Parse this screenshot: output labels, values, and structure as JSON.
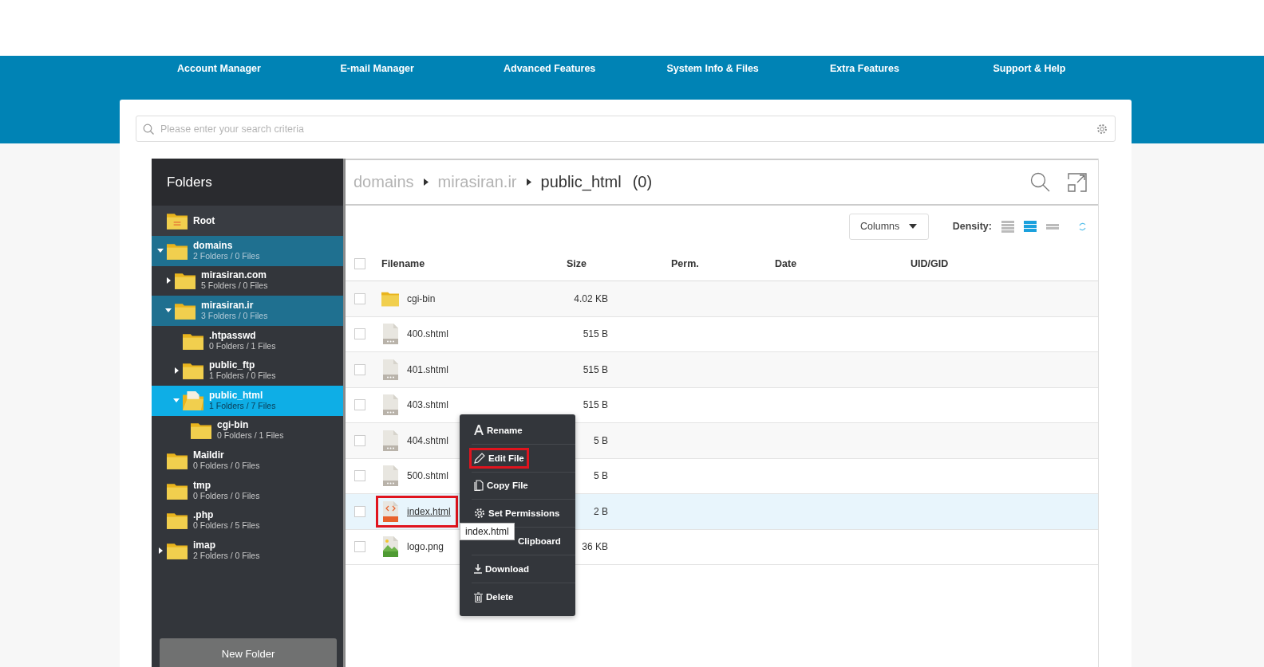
{
  "nav": [
    {
      "label": "Account Manager"
    },
    {
      "label": "E-mail Manager"
    },
    {
      "label": "Advanced Features"
    },
    {
      "label": "System Info & Files"
    },
    {
      "label": "Extra Features"
    },
    {
      "label": "Support & Help"
    }
  ],
  "search": {
    "placeholder": "Please enter your search criteria"
  },
  "sidebar": {
    "title": "Folders",
    "folders": [
      {
        "name": "Root",
        "kind": "root",
        "selected": false
      },
      {
        "name": "domains",
        "info": "2 Folders / 0 Files",
        "kind": "folder",
        "expanded": true,
        "selected": false,
        "children": [
          {
            "name": "mirasiran.com",
            "info": "5 Folders / 0 Files",
            "kind": "folder",
            "expanded": false,
            "selected": false
          },
          {
            "name": "mirasiran.ir",
            "info": "3 Folders / 0 Files",
            "kind": "folder",
            "expanded": true,
            "selected": false,
            "children": [
              {
                "name": ".htpasswd",
                "info": "0 Folders / 1 Files",
                "kind": "folder",
                "selected": false
              },
              {
                "name": "public_ftp",
                "info": "1 Folders / 0 Files",
                "kind": "folder",
                "expanded": false,
                "selected": false
              },
              {
                "name": "public_html",
                "info": "1 Folders / 7 Files",
                "kind": "open-folder",
                "expanded": true,
                "selected": true,
                "children": [
                  {
                    "name": "cgi-bin",
                    "info": "0 Folders / 1 Files",
                    "kind": "folder",
                    "selected": false
                  }
                ]
              }
            ]
          }
        ]
      },
      {
        "name": "Maildir",
        "info": "0 Folders / 0 Files",
        "kind": "folder",
        "selected": false
      },
      {
        "name": "tmp",
        "info": "0 Folders / 0 Files",
        "kind": "folder",
        "selected": false
      },
      {
        "name": ".php",
        "info": "0 Folders / 5 Files",
        "kind": "folder",
        "selected": false
      },
      {
        "name": "imap",
        "info": "2 Folders / 0 Files",
        "kind": "folder",
        "expanded": false,
        "selected": false
      }
    ],
    "button": "New Folder"
  },
  "breadcrumb": [
    {
      "label": "domains",
      "selected": false
    },
    {
      "label": "mirasiran.ir",
      "selected": false
    },
    {
      "label": "public_html",
      "selected": true
    }
  ],
  "breadcrumb_count": "(0)",
  "toolbar": {
    "columns_button": "Columns",
    "density_label": "Density:",
    "density": [
      {
        "selected": false
      },
      {
        "selected": true
      },
      {
        "selected": false
      }
    ]
  },
  "table": {
    "all_checked": false,
    "columns": [
      "Filename",
      "Size",
      "Perm.",
      "Date",
      "UID/GID"
    ],
    "rows": [
      {
        "kind": "folder",
        "name": "cgi-bin",
        "size": "4.02 KB",
        "checked": false,
        "selected": false,
        "highlighted": false
      },
      {
        "kind": "shtml",
        "name": "400.shtml",
        "size": "515 B",
        "checked": false,
        "selected": false,
        "highlighted": false
      },
      {
        "kind": "shtml",
        "name": "401.shtml",
        "size": "515 B",
        "checked": false,
        "selected": false,
        "highlighted": false
      },
      {
        "kind": "shtml",
        "name": "403.shtml",
        "size": "515 B",
        "checked": false,
        "selected": false,
        "highlighted": false
      },
      {
        "kind": "shtml",
        "name": "404.shtml",
        "size": "5 B",
        "checked": false,
        "selected": false,
        "highlighted": false
      },
      {
        "kind": "shtml",
        "name": "500.shtml",
        "size": "5 B",
        "checked": false,
        "selected": false,
        "highlighted": false
      },
      {
        "kind": "html",
        "name": "index.html",
        "size": "2 B",
        "checked": false,
        "selected": true,
        "highlighted": true
      },
      {
        "kind": "png",
        "name": "logo.png",
        "size": "36 KB",
        "checked": false,
        "selected": false,
        "highlighted": false
      }
    ]
  },
  "context_menu": [
    {
      "kind": "rename",
      "label": "Rename",
      "highlighted": false
    },
    {
      "kind": "edit",
      "label": "Edit File",
      "highlighted": true
    },
    {
      "kind": "copy",
      "label": "Copy File",
      "highlighted": false
    },
    {
      "kind": "permissions",
      "label": "Set Permissions",
      "highlighted": false
    },
    {
      "kind": "clipboard",
      "label": "Clipboard",
      "highlighted": false
    },
    {
      "kind": "download",
      "label": "Download",
      "highlighted": false
    },
    {
      "kind": "delete",
      "label": "Delete",
      "highlighted": false
    }
  ],
  "tooltip": "index.html"
}
